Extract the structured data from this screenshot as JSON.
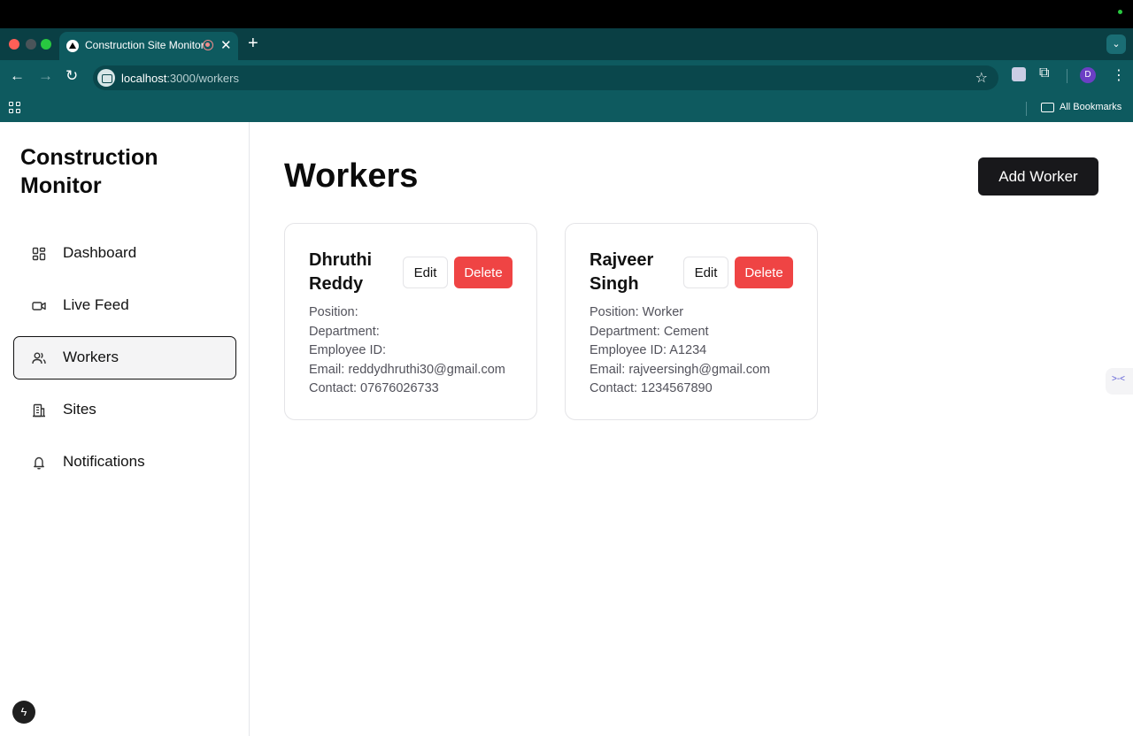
{
  "browser": {
    "tab_title": "Construction Site Monitor",
    "tab_close": "✕",
    "new_tab": "+",
    "url_host": "localhost",
    "url_path": ":3000/workers",
    "profile_initial": "D",
    "bookmarks_label": "All Bookmarks"
  },
  "sidebar": {
    "brand": "Construction Monitor",
    "items": [
      {
        "label": "Dashboard",
        "icon": "dashboard-icon"
      },
      {
        "label": "Live Feed",
        "icon": "video-icon"
      },
      {
        "label": "Workers",
        "icon": "users-icon",
        "active": true
      },
      {
        "label": "Sites",
        "icon": "building-icon"
      },
      {
        "label": "Notifications",
        "icon": "bell-icon"
      }
    ]
  },
  "main": {
    "title": "Workers",
    "add_button": "Add Worker",
    "workers": [
      {
        "name": "Dhruthi Reddy",
        "edit_label": "Edit",
        "delete_label": "Delete",
        "position": "Position:",
        "department": "Department:",
        "employee_id": "Employee ID:",
        "email": "Email: reddydhruthi30@gmail.com",
        "contact": "Contact: 07676026733"
      },
      {
        "name": "Rajveer Singh",
        "edit_label": "Edit",
        "delete_label": "Delete",
        "position": "Position: Worker",
        "department": "Department: Cement",
        "employee_id": "Employee ID: A1234",
        "email": "Email: rajveersingh@gmail.com",
        "contact": "Contact: 1234567890"
      }
    ]
  },
  "colors": {
    "chrome": "#0e5a5f",
    "delete": "#ef4444",
    "primary": "#18181b"
  }
}
